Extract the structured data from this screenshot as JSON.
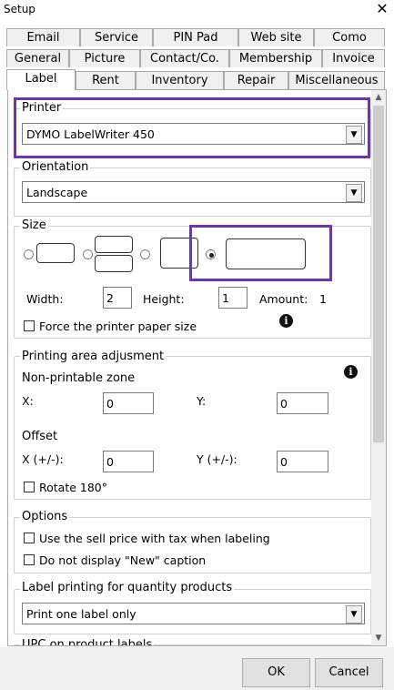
{
  "window": {
    "title": "Setup",
    "close_glyph": "✕"
  },
  "tabs": {
    "row1": [
      "Email",
      "Service",
      "PIN Pad",
      "Web site",
      "Como"
    ],
    "row2": [
      "General",
      "Picture",
      "Contact/Co.",
      "Membership",
      "Invoice"
    ],
    "row3": [
      "Label",
      "Rent",
      "Inventory",
      "Repair",
      "Miscellaneous"
    ],
    "selected": "Label"
  },
  "printer": {
    "label": "Printer",
    "value": "DYMO LabelWriter 450"
  },
  "orientation": {
    "label": "Orientation",
    "value": "Landscape"
  },
  "size": {
    "label": "Size",
    "width_label": "Width:",
    "width_value": "2",
    "height_label": "Height:",
    "height_value": "1",
    "amount_label": "Amount:",
    "amount_value": "1",
    "force_label": "Force the printer paper size",
    "selected_option": 4
  },
  "printing_area": {
    "label": "Printing area adjusment",
    "zone_label": "Non-printable zone",
    "x_label": "X:",
    "x_value": "0",
    "y_label": "Y:",
    "y_value": "0",
    "offset_label": "Offset",
    "ox_label": "X (+/-):",
    "ox_value": "0",
    "oy_label": "Y (+/-):",
    "oy_value": "0",
    "rotate_label": "Rotate 180°"
  },
  "options": {
    "label": "Options",
    "sell_price_label": "Use the sell price with tax when labeling",
    "new_caption_label": "Do not display \"New\" caption"
  },
  "quantity": {
    "label": "Label printing for quantity products",
    "value": "Print one label only"
  },
  "upc": {
    "label": "UPC on product labels"
  },
  "buttons": {
    "ok": "OK",
    "cancel": "Cancel"
  },
  "icons": {
    "info": "i",
    "dropdown": "▼",
    "scroll_up": "▲",
    "scroll_down": "▼"
  },
  "colors": {
    "highlight": "#6a3aa0",
    "tab_bg": "#f0f0f0",
    "border": "#a9a9a9"
  }
}
